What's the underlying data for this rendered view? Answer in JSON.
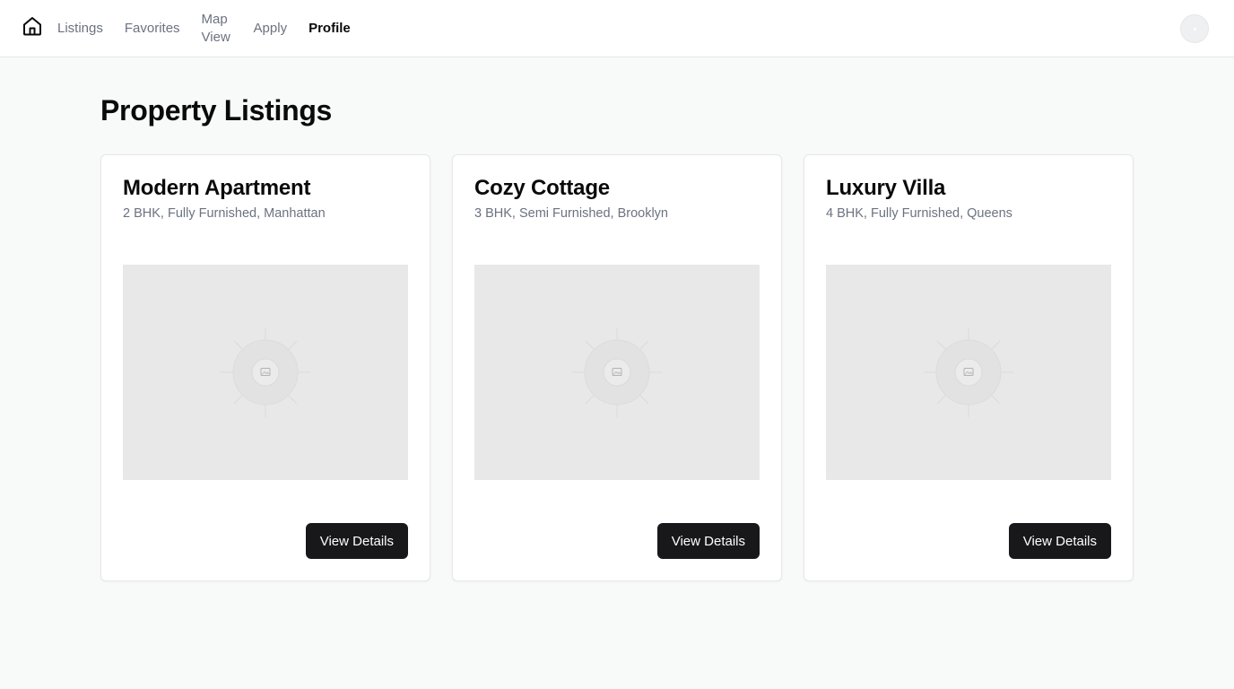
{
  "nav": {
    "home_icon": "house-icon",
    "items": [
      {
        "label": "Listings",
        "active": false
      },
      {
        "label": "Favorites",
        "active": false
      },
      {
        "label": "Map\nView",
        "active": false
      },
      {
        "label": "Apply",
        "active": false
      },
      {
        "label": "Profile",
        "active": true
      }
    ],
    "avatar_icon": "user-avatar"
  },
  "page": {
    "title": "Property Listings"
  },
  "listings": [
    {
      "title": "Modern Apartment",
      "details": "2 BHK, Fully Furnished, Manhattan",
      "button": "View Details",
      "image_icon": "image-placeholder-icon"
    },
    {
      "title": "Cozy Cottage",
      "details": "3 BHK, Semi Furnished, Brooklyn",
      "button": "View Details",
      "image_icon": "image-placeholder-icon"
    },
    {
      "title": "Luxury Villa",
      "details": "4 BHK, Fully Furnished, Queens",
      "button": "View Details",
      "image_icon": "image-placeholder-icon"
    }
  ],
  "colors": {
    "background": "#f8f9f9",
    "button": "#18181b",
    "muted_text": "#6b7280",
    "placeholder": "#e8e8e8"
  }
}
